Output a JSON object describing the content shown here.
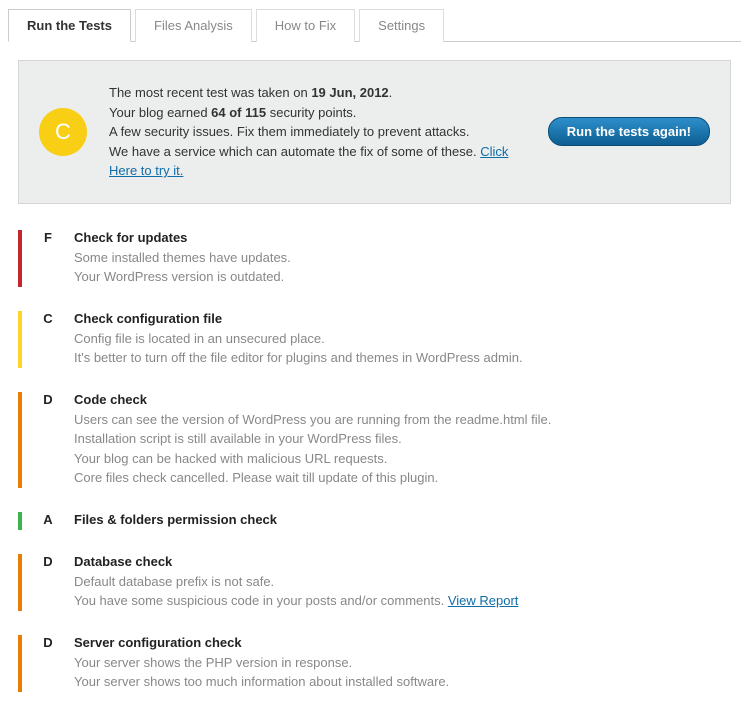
{
  "tabs": {
    "run": "Run the Tests",
    "files": "Files Analysis",
    "how": "How to Fix",
    "settings": "Settings"
  },
  "summary": {
    "grade": "C",
    "line1a": "The most recent test was taken on ",
    "line1b": "19 Jun, 2012",
    "line1c": ".",
    "line2a": "Your blog earned ",
    "line2b": "64 of 115",
    "line2c": " security points.",
    "line3": "A few security issues. Fix them immediately to prevent attacks.",
    "line4a": "We have a service which can automate the fix of some of these. ",
    "line4link": "Click Here to try it.",
    "button": "Run the tests again!"
  },
  "grade_colors": {
    "F": "#c1272d",
    "C": "#ffd42a",
    "D": "#e87e04",
    "A": "#3cb44a"
  },
  "results": [
    {
      "grade": "F",
      "title": "Check for updates",
      "lines": [
        "Some installed themes have updates.",
        "Your WordPress version is outdated."
      ]
    },
    {
      "grade": "C",
      "title": "Check configuration file",
      "lines": [
        "Config file is located in an unsecured place.",
        "It's better to turn off the file editor for plugins and themes in WordPress admin."
      ]
    },
    {
      "grade": "D",
      "title": "Code check",
      "lines": [
        "Users can see the version of WordPress you are running from the readme.html file.",
        "Installation script is still available in your WordPress files.",
        "Your blog can be hacked with malicious URL requests.",
        "Core files check cancelled. Please wait till update of this plugin."
      ]
    },
    {
      "grade": "A",
      "title": "Files & folders permission check",
      "lines": []
    },
    {
      "grade": "D",
      "title": "Database check",
      "lines": [
        "Default database prefix is not safe.",
        "You have some suspicious code in your posts and/or comments. "
      ],
      "trailing_link": "View Report"
    },
    {
      "grade": "D",
      "title": "Server configuration check",
      "lines": [
        "Your server shows the PHP version in response.",
        "Your server shows too much information about installed software."
      ]
    }
  ]
}
